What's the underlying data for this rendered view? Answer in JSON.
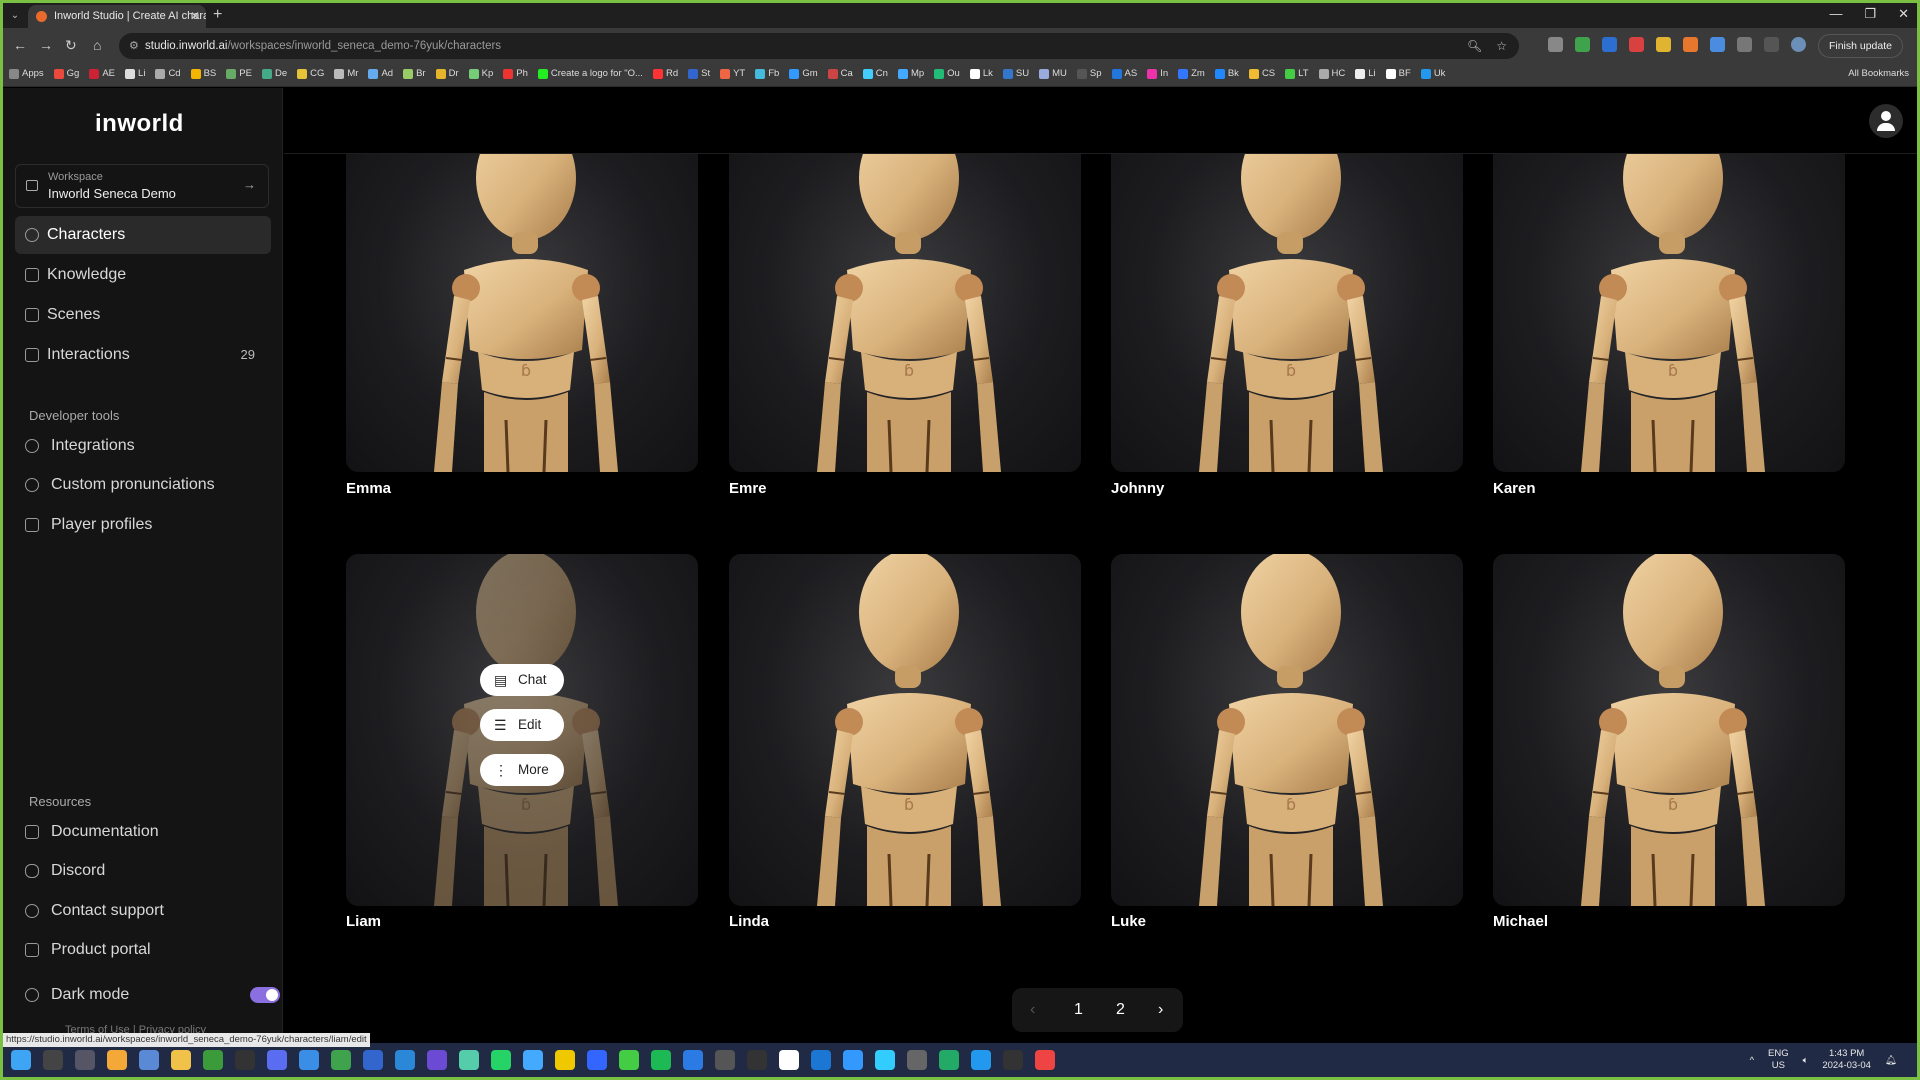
{
  "browser": {
    "tab_title": "Inworld Studio | Create AI chara",
    "url_host": "studio.inworld.ai",
    "url_path": "/workspaces/inworld_seneca_demo-76yuk/characters",
    "finish_update": "Finish update",
    "bookmarks": [
      "Apps",
      "Gg",
      "AE",
      "Li",
      "Cd",
      "BS",
      "PE",
      "De",
      "CG",
      "Mr",
      "Ad",
      "Br",
      "Dr",
      "Kp",
      "Ph",
      "Create a logo for \"O...",
      "Rd",
      "St",
      "YT",
      "Fb",
      "Gm",
      "Ca",
      "Cn",
      "Mp",
      "Ou",
      "Lk",
      "SU",
      "MU",
      "Sp",
      "AS",
      "In",
      "Zm",
      "Bk",
      "CS",
      "LT",
      "HC",
      "Li",
      "BF",
      "Uk"
    ],
    "all_bookmarks": "All Bookmarks",
    "status_url": "https://studio.inworld.ai/workspaces/inworld_seneca_demo-76yuk/characters/liam/edit"
  },
  "sidebar": {
    "logo": "inworld",
    "workspace_label": "Workspace",
    "workspace_name": "Inworld Seneca Demo",
    "nav": [
      {
        "label": "Characters"
      },
      {
        "label": "Knowledge"
      },
      {
        "label": "Scenes"
      },
      {
        "label": "Interactions",
        "count": "29"
      }
    ],
    "dev_tools_heading": "Developer tools",
    "dev_tools": [
      {
        "label": "Integrations"
      },
      {
        "label": "Custom pronunciations"
      },
      {
        "label": "Player profiles"
      }
    ],
    "resources_heading": "Resources",
    "resources": [
      {
        "label": "Documentation"
      },
      {
        "label": "Discord"
      },
      {
        "label": "Contact support"
      },
      {
        "label": "Product portal"
      }
    ],
    "dark_mode_label": "Dark mode",
    "dark_mode_on": true,
    "footer": "Terms of Use | Privacy policy"
  },
  "characters": [
    "Emma",
    "Emre",
    "Johnny",
    "Karen",
    "Liam",
    "Linda",
    "Luke",
    "Michael"
  ],
  "hover_menu": {
    "chat": "Chat",
    "edit": "Edit",
    "more": "More"
  },
  "pagination": {
    "prev": "‹",
    "pages": [
      "1",
      "2"
    ],
    "next": "›"
  },
  "taskbar": {
    "lang_top": "ENG",
    "lang_bottom": "US",
    "time": "1:43 PM",
    "date": "2024-03-04"
  }
}
